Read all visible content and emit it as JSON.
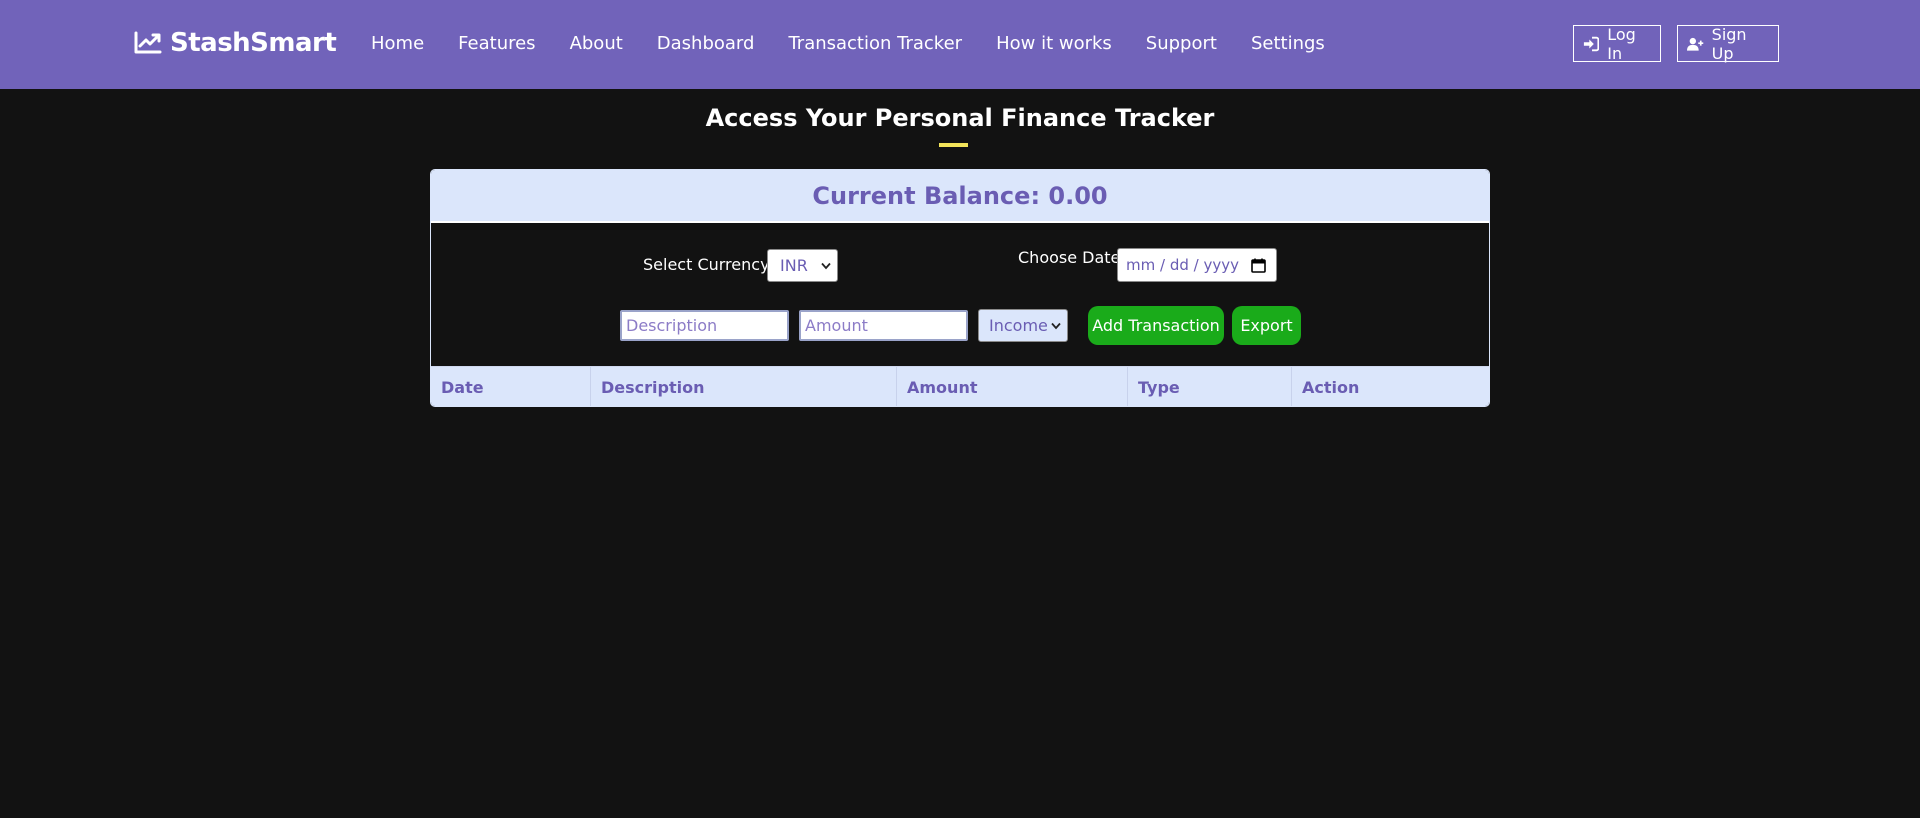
{
  "brand": {
    "name": "StashSmart",
    "icon": "chart-line-icon"
  },
  "nav": {
    "links": [
      "Home",
      "Features",
      "About",
      "Dashboard",
      "Transaction Tracker",
      "How it works",
      "Support",
      "Settings"
    ]
  },
  "auth": {
    "login_label": "Log In",
    "login_icon": "sign-in-icon",
    "signup_label": "Sign Up",
    "signup_icon": "user-plus-icon"
  },
  "page": {
    "title": "Access Your Personal Finance Tracker"
  },
  "tracker": {
    "balance_label": "Current Balance: 0.00",
    "currency_label": "Select Currency:",
    "currency_value": "INR",
    "date_label": "Choose Date:",
    "date_placeholder": "mm / dd / yyyy",
    "description_placeholder": "Description",
    "amount_placeholder": "Amount",
    "type_value": "Income",
    "add_label": "Add Transaction",
    "export_label": "Export"
  },
  "table": {
    "headers": [
      "Date",
      "Description",
      "Amount",
      "Type",
      "Action"
    ],
    "rows": []
  },
  "colors": {
    "navbar": "#7163ba",
    "background": "#121212",
    "card_header": "#dbe6fb",
    "accent_text": "#6a5db3",
    "button_green": "#1aab1a",
    "underline": "#f2e45a"
  }
}
